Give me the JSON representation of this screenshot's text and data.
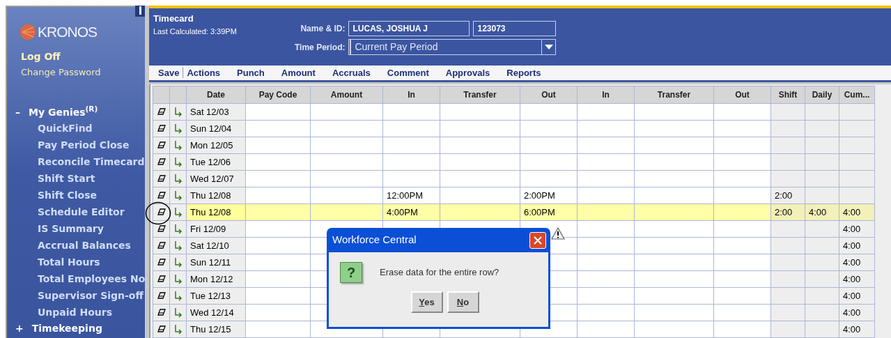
{
  "sidebar": {
    "logo": "KRONOS",
    "links": [
      {
        "label": "Log Off",
        "kind": "primary"
      },
      {
        "label": "Change Password",
        "kind": "secondary"
      }
    ],
    "sections": [
      {
        "sign": "–",
        "label": "My Genies$^{(R)}$",
        "children": [
          "QuickFind",
          "Pay Period Close",
          "Reconcile Timecard",
          "Shift Start",
          "Shift Close",
          "Schedule Editor",
          "IS Summary",
          "Accrual Balances",
          "Total Hours",
          "Total Employees No",
          "Supervisor Sign-off",
          "Unpaid Hours"
        ]
      },
      {
        "sign": "+",
        "label": "Timekeeping"
      }
    ]
  },
  "header": {
    "title": "Timecard",
    "last_calculated": "Last Calculated: 3:39PM",
    "name_label": "Name & ID:",
    "name": "LUCAS, JOSHUA J",
    "id": "123073",
    "period_label": "Time Period:",
    "period": "Current Pay Period"
  },
  "toolbar": [
    "Save",
    "Actions",
    "Punch",
    "Amount",
    "Accruals",
    "Comment",
    "Approvals",
    "Reports"
  ],
  "table": {
    "columns": [
      "Date",
      "Pay Code",
      "Amount",
      "In",
      "Transfer",
      "Out",
      "In",
      "Transfer",
      "Out",
      "Shift",
      "Daily",
      "Cum..."
    ],
    "rows": [
      {
        "date": "Sat 12/03",
        "selected": false
      },
      {
        "date": "Sun 12/04",
        "selected": false
      },
      {
        "date": "Mon 12/05",
        "selected": false
      },
      {
        "date": "Tue 12/06",
        "selected": false
      },
      {
        "date": "Wed 12/07",
        "selected": false
      },
      {
        "date": "Thu 12/08",
        "in": "12:00PM",
        "out": "2:00PM",
        "shift": "2:00",
        "selected": false
      },
      {
        "date": "Thu 12/08",
        "in": "4:00PM",
        "out": "6:00PM",
        "shift": "2:00",
        "daily": "4:00",
        "cum": "4:00",
        "selected": true
      },
      {
        "date": "Fri 12/09",
        "cum": "4:00",
        "selected": false
      },
      {
        "date": "Sat 12/10",
        "cum": "4:00",
        "selected": false
      },
      {
        "date": "Sun 12/11",
        "cum": "4:00",
        "selected": false
      },
      {
        "date": "Mon 12/12",
        "cum": "4:00",
        "selected": false
      },
      {
        "date": "Tue 12/13",
        "cum": "4:00",
        "selected": false
      },
      {
        "date": "Wed 12/14",
        "cum": "4:00",
        "selected": false
      },
      {
        "date": "Thu 12/15",
        "cum": "4:00",
        "selected": false
      }
    ]
  },
  "dialog": {
    "title": "Workforce Central",
    "icon": "?",
    "message": "Erase data for the entire row?",
    "buttons": [
      "Yes",
      "No"
    ]
  }
}
